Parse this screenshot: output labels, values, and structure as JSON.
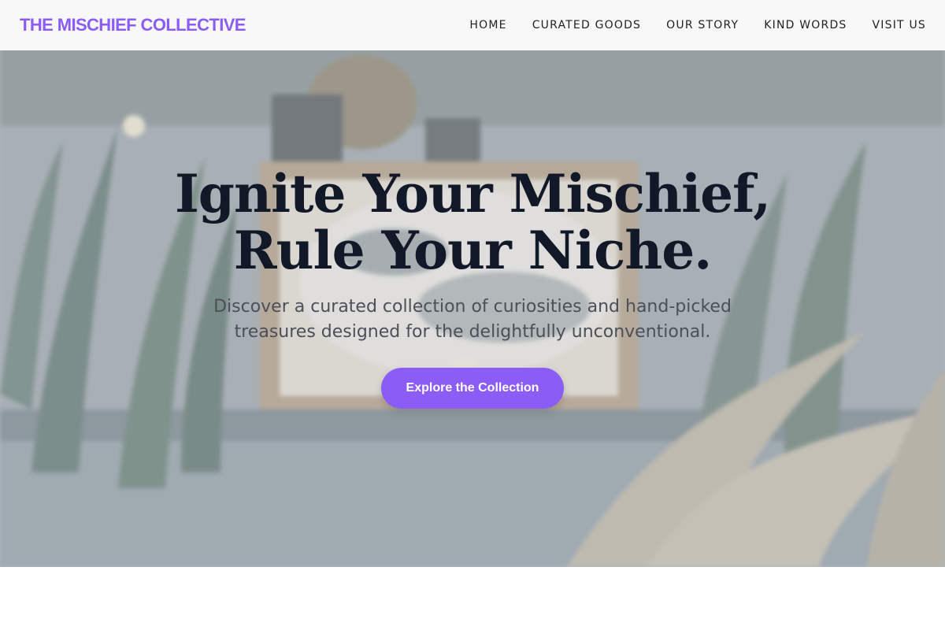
{
  "header": {
    "logo": "THE MISCHIEF COLLECTIVE",
    "nav": [
      {
        "label": "HOME"
      },
      {
        "label": "CURATED GOODS"
      },
      {
        "label": "OUR STORY"
      },
      {
        "label": "KIND WORDS"
      },
      {
        "label": "VISIT US"
      }
    ]
  },
  "hero": {
    "title_line1": "Ignite Your Mischief,",
    "title_line2": "Rule Your Niche.",
    "subtitle": "Discover a curated collection of curiosities and hand-picked treasures designed for the delightfully unconventional.",
    "cta_label": "Explore the Collection",
    "background_image": "blurred shop window with plants and a lit 'We're Open' sign"
  },
  "colors": {
    "accent": "#8b5cf6",
    "title": "#111827",
    "subtitle": "#4b4f58",
    "nav_text": "#222222"
  }
}
